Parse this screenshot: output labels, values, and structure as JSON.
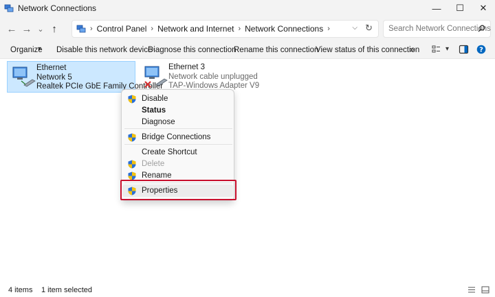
{
  "window": {
    "title": "Network Connections",
    "controls": {
      "minimize": "—",
      "maximize": "☐",
      "close": "✕"
    }
  },
  "address": {
    "back_icon": "back-arrow-icon",
    "forward_icon": "forward-arrow-icon",
    "recent_icon": "chevron-down-icon",
    "up_icon": "up-arrow-icon",
    "separator": "›",
    "breadcrumbs": [
      "Control Panel",
      "Network and Internet",
      "Network Connections"
    ],
    "search_placeholder": "Search Network Connections"
  },
  "commands": {
    "organize": "Organize",
    "disable_device": "Disable this network device",
    "diagnose": "Diagnose this connection",
    "rename": "Rename this connection",
    "view_status": "View status of this connection",
    "more": "»"
  },
  "items": [
    {
      "name": "Ethernet",
      "status": "Network 5",
      "adapter": "Realtek PCIe GbE Family Controller",
      "selected": true,
      "disconnected": false
    },
    {
      "name": "Ethernet 3",
      "status": "Network cable unplugged",
      "adapter": "TAP-Windows Adapter V9",
      "selected": false,
      "disconnected": true
    }
  ],
  "context_menu": {
    "items": [
      {
        "label": "Disable",
        "shield": true,
        "bold": false,
        "disabled": false
      },
      {
        "label": "Status",
        "shield": false,
        "bold": true,
        "disabled": false
      },
      {
        "label": "Diagnose",
        "shield": false,
        "bold": false,
        "disabled": false
      },
      {
        "label": "Bridge Connections",
        "shield": true,
        "bold": false,
        "disabled": false
      },
      {
        "label": "Create Shortcut",
        "shield": false,
        "bold": false,
        "disabled": false
      },
      {
        "label": "Delete",
        "shield": true,
        "bold": false,
        "disabled": true
      },
      {
        "label": "Rename",
        "shield": true,
        "bold": false,
        "disabled": false
      },
      {
        "label": "Properties",
        "shield": true,
        "bold": false,
        "disabled": false,
        "highlighted": true
      }
    ]
  },
  "status": {
    "count": "4 items",
    "selected": "1 item selected"
  },
  "colors": {
    "chrome": "#f3f3f3",
    "selection": "#cce8ff",
    "selection_border": "#99d1ff",
    "highlight_box": "#c8102e",
    "accent": "#0067c0"
  }
}
